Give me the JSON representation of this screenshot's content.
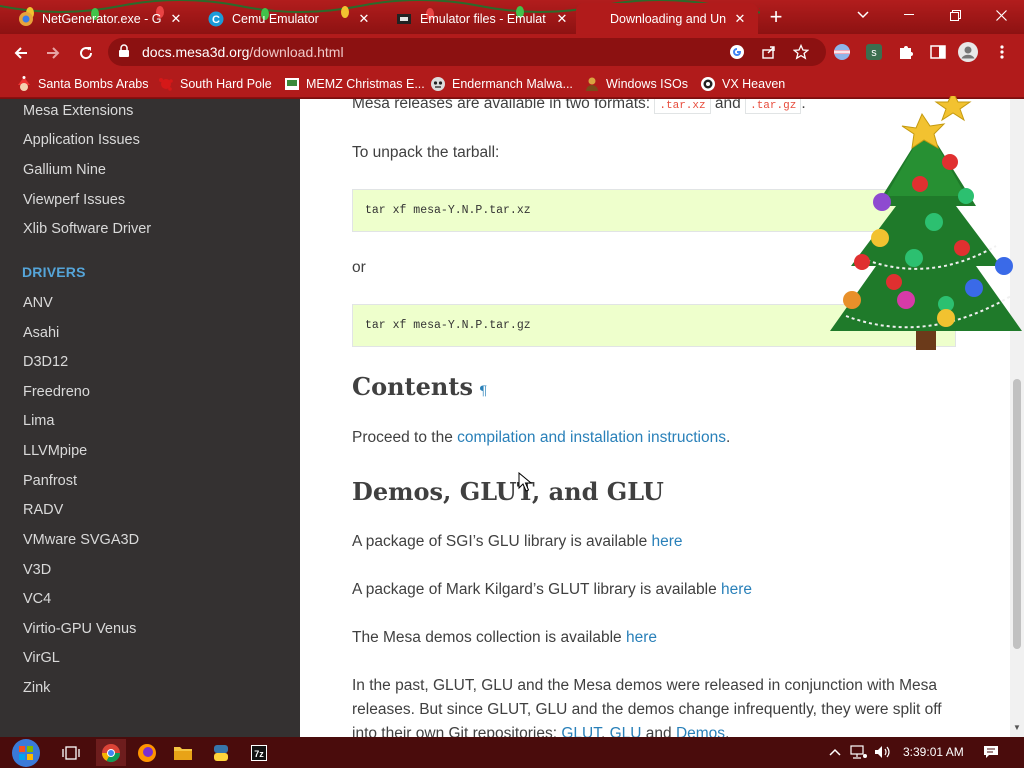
{
  "tabs": [
    {
      "title": "NetGenerator.exe - Go",
      "favicon": "colorful-app-icon"
    },
    {
      "title": "Cemu Emulator",
      "favicon": "cemu-c-icon"
    },
    {
      "title": "Emulator files - Emulat",
      "favicon": "emulator-site-icon"
    },
    {
      "title": "Downloading and Unpa",
      "favicon": "mesa-icon",
      "active": true
    }
  ],
  "toolbar": {
    "url_host": "docs.mesa3d.org",
    "url_path": "/download.html"
  },
  "bookmarks": [
    {
      "label": "Santa Bombs Arabs",
      "icon": "santa-icon"
    },
    {
      "label": "South Hard Pole",
      "icon": "splat-icon"
    },
    {
      "label": "MEMZ Christmas E...",
      "icon": "memz-icon"
    },
    {
      "label": "Endermanch Malwa...",
      "icon": "endermanch-icon"
    },
    {
      "label": "Windows ISOs",
      "icon": "person-icon"
    },
    {
      "label": "VX Heaven",
      "icon": "vx-heaven-icon"
    }
  ],
  "sidebar": {
    "items_top": [
      "Mesa Extensions",
      "Application Issues",
      "Gallium Nine",
      "Viewperf Issues",
      "Xlib Software Driver"
    ],
    "drivers_heading": "DRIVERS",
    "drivers": [
      "ANV",
      "Asahi",
      "D3D12",
      "Freedreno",
      "Lima",
      "LLVMpipe",
      "Panfrost",
      "RADV",
      "VMware SVGA3D",
      "V3D",
      "VC4",
      "Virtio-GPU Venus",
      "VirGL",
      "Zink"
    ]
  },
  "content": {
    "formats_text_a": "Mesa releases are available in two formats: ",
    "format_xz": ".tar.xz",
    "formats_and": " and ",
    "format_gz": ".tar.gz",
    "formats_end": ".",
    "unpack_text": "To unpack the tarball:",
    "code_xz": "tar xf mesa-Y.N.P.tar.xz",
    "or_text": "or",
    "code_gz": "tar xf mesa-Y.N.P.tar.gz",
    "contents_heading": "Contents",
    "pilcrow": "¶",
    "proceed_text": "Proceed to the ",
    "proceed_link": "compilation and installation instructions",
    "proceed_end": ".",
    "demos_heading": "Demos, GLUT, and GLU",
    "glu_text": "A package of SGI’s GLU library is available ",
    "glut_text": "A package of Mark Kilgard’s GLUT library is available ",
    "demos_text": "The Mesa demos collection is available ",
    "here": "here",
    "past_line1": "In the past, GLUT, GLU and the Mesa demos were released in conjunction with Mesa",
    "past_line2": "releases. But since GLUT, GLU and the demos change infrequently, they were split off",
    "past_line3_a": "into their own Git repositories: ",
    "past_link_glut": "GLUT",
    "past_comma": ", ",
    "past_link_glu": "GLU",
    "past_and": " and ",
    "past_link_demos": "Demos",
    "past_end": "."
  },
  "taskbar": {
    "clock": "3:39:01 AM"
  }
}
